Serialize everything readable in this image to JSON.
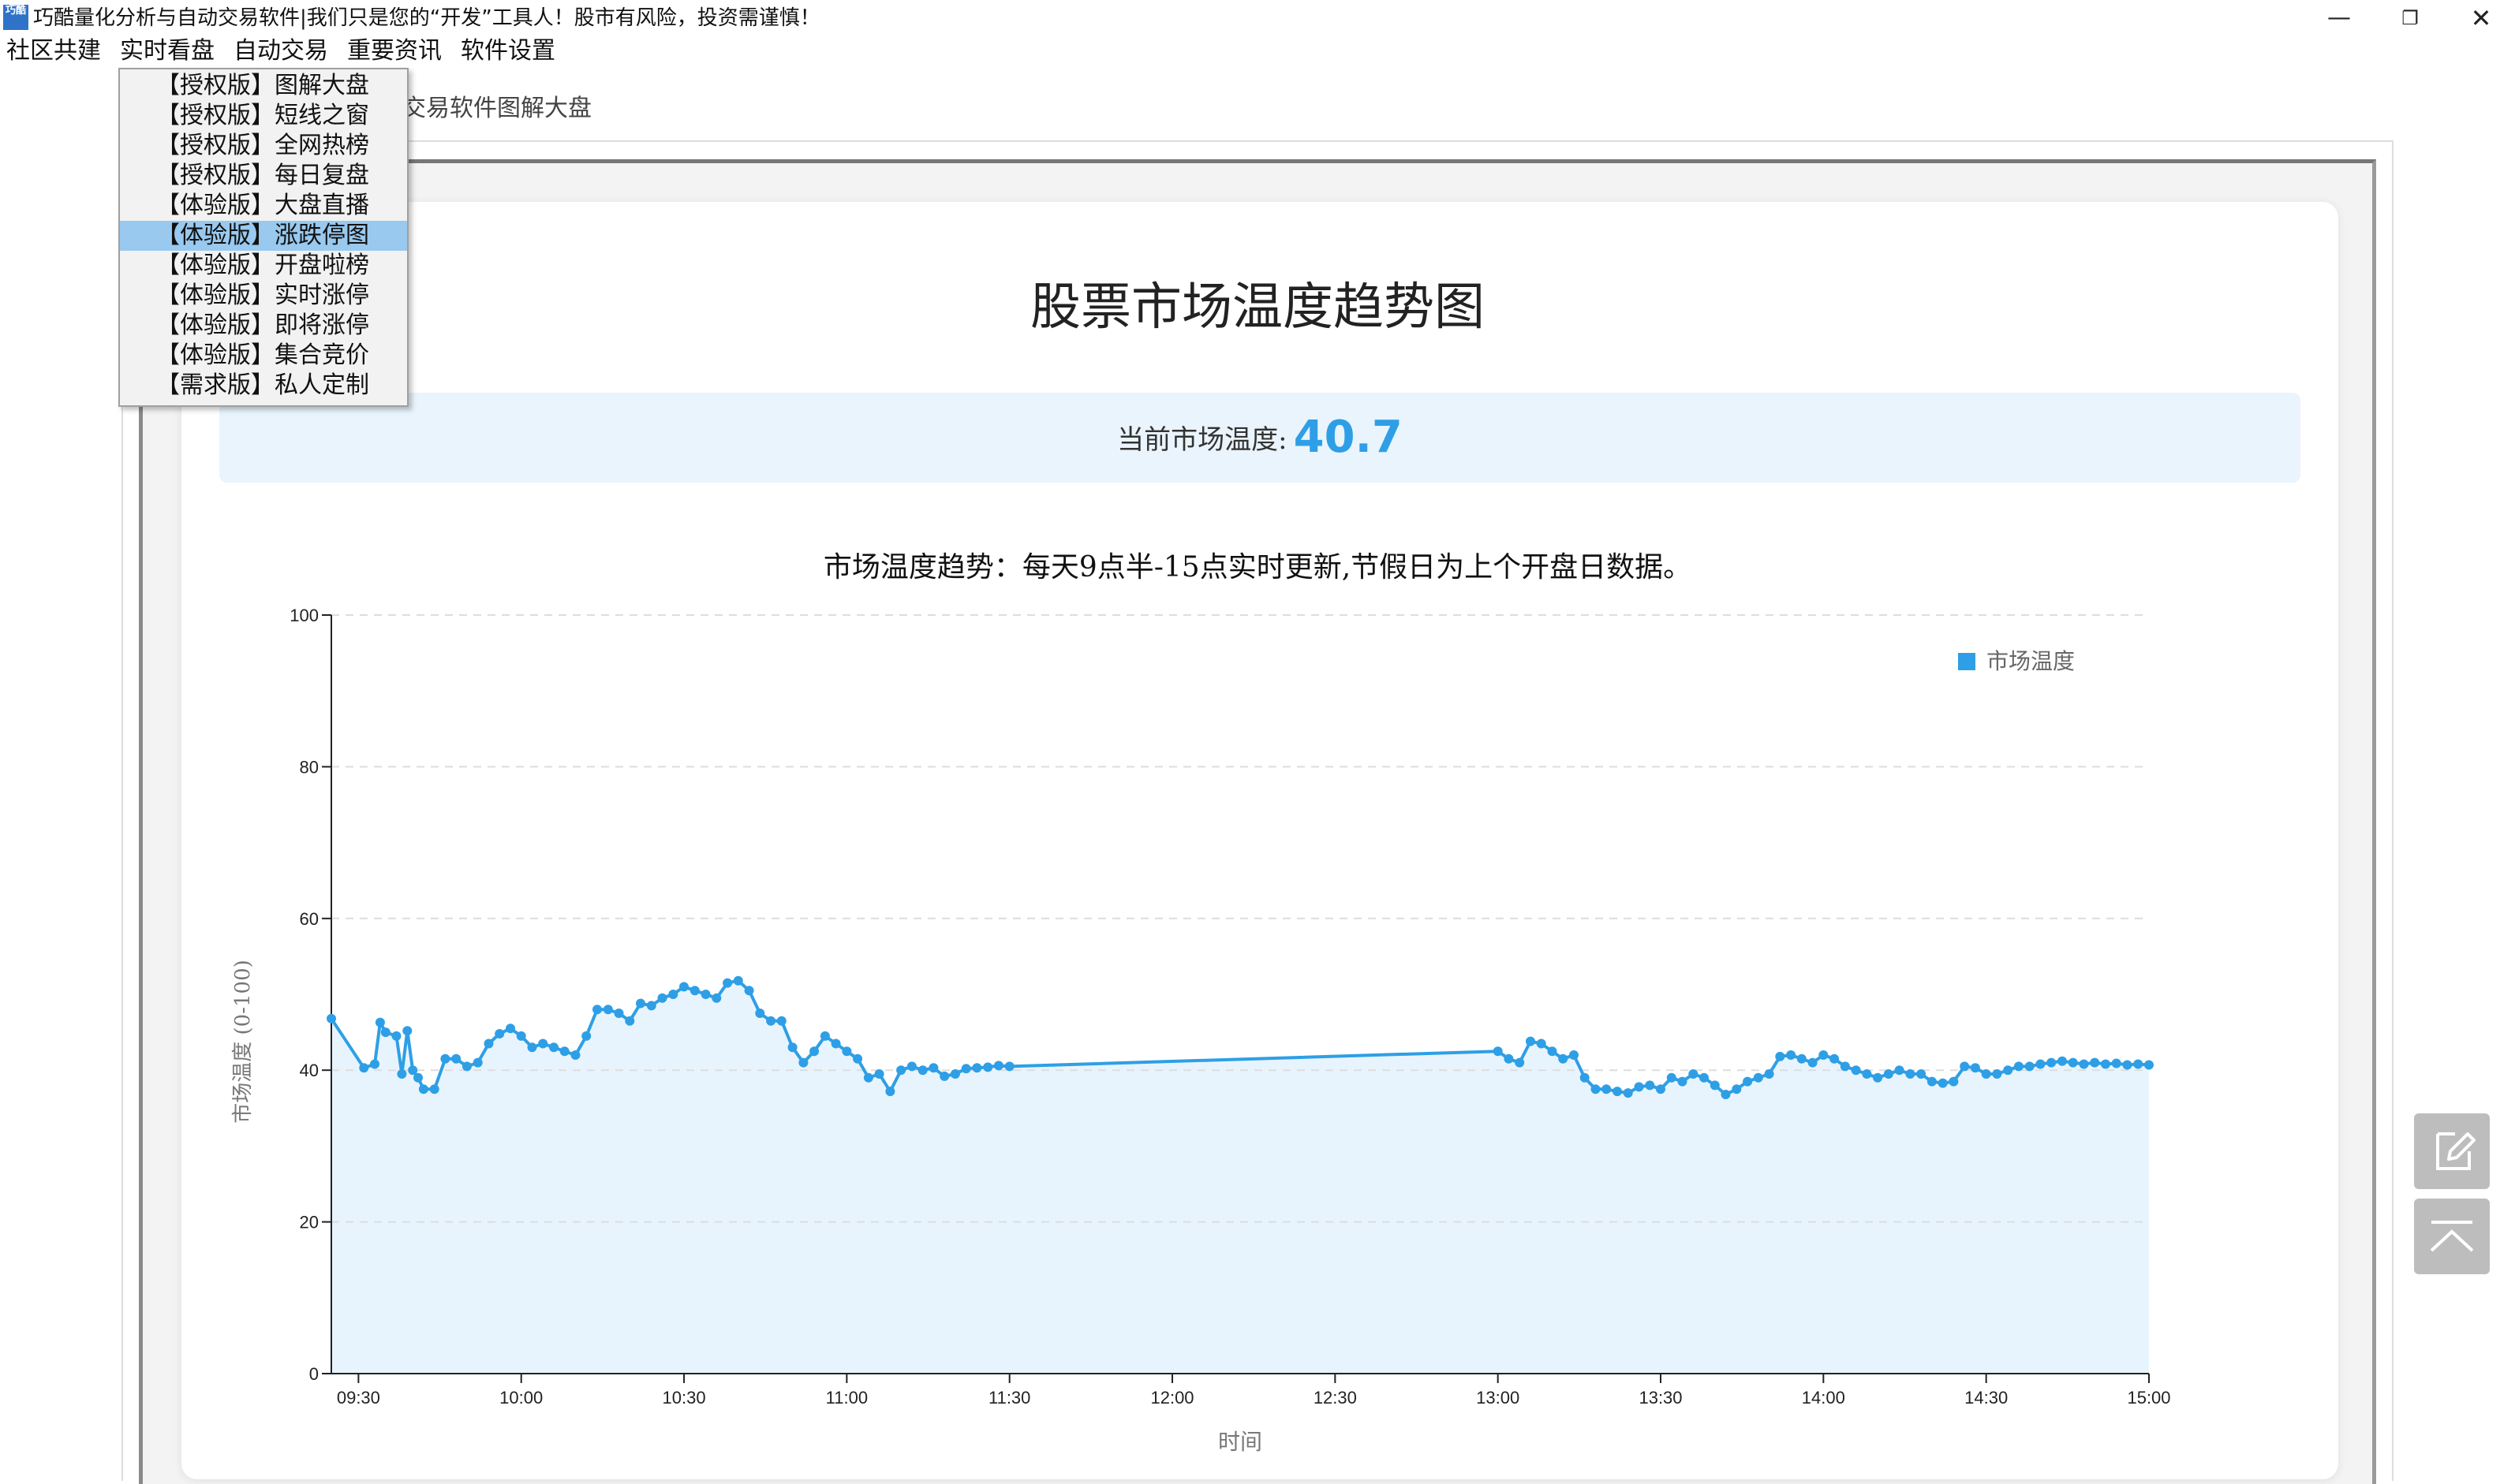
{
  "window": {
    "app_icon_text": "巧酷",
    "title": "巧酷量化分析与自动交易软件|我们只是您的“开发”工具人！股市有风险，投资需谨慎！",
    "minimize_symbol": "—",
    "maximize_symbol": "❐",
    "close_symbol": "✕"
  },
  "menubar": {
    "items": [
      "社区共建",
      "实时看盘",
      "自动交易",
      "重要资讯",
      "软件设置"
    ]
  },
  "dropdown": {
    "items": [
      "【授权版】图解大盘",
      "【授权版】短线之窗",
      "【授权版】全网热榜",
      "【授权版】每日复盘",
      "【体验版】大盘直播",
      "【体验版】涨跌停图",
      "【体验版】开盘啦榜",
      "【体验版】实时涨停",
      "【体验版】即将涨停",
      "【体验版】集合竞价",
      "【需求版】私人定制"
    ],
    "selected_index": 5
  },
  "breadcrumb": "交易软件图解大盘",
  "page": {
    "title": "股票市场温度趋势图",
    "current_label": "当前市场温度:",
    "current_value": "40.7"
  },
  "colors": {
    "accent": "#2e9fe6",
    "area_fill": "#e8f4fd",
    "selection": "#99c9ef"
  },
  "chart_data": {
    "type": "area",
    "title": "市场温度趋势：每天9点半-15点实时更新,节假日为上个开盘日数据。",
    "xlabel": "时间",
    "ylabel": "市场温度 (0-100)",
    "ylim": [
      0,
      100
    ],
    "yticks": [
      0,
      20,
      40,
      60,
      80,
      100
    ],
    "xlim": [
      "09:25",
      "15:00"
    ],
    "xticks": [
      "09:30",
      "10:00",
      "10:30",
      "11:00",
      "11:30",
      "12:00",
      "12:30",
      "13:00",
      "13:30",
      "14:00",
      "14:30",
      "15:00"
    ],
    "grid": "horizontal dashed",
    "legend_position": "top-right",
    "series": [
      {
        "name": "市场温度",
        "x": [
          "09:25",
          "09:31",
          "09:33",
          "09:34",
          "09:35",
          "09:37",
          "09:38",
          "09:39",
          "09:40",
          "09:41",
          "09:42",
          "09:44",
          "09:46",
          "09:48",
          "09:50",
          "09:52",
          "09:54",
          "09:56",
          "09:58",
          "10:00",
          "10:02",
          "10:04",
          "10:06",
          "10:08",
          "10:10",
          "10:12",
          "10:14",
          "10:16",
          "10:18",
          "10:20",
          "10:22",
          "10:24",
          "10:26",
          "10:28",
          "10:30",
          "10:32",
          "10:34",
          "10:36",
          "10:38",
          "10:40",
          "10:42",
          "10:44",
          "10:46",
          "10:48",
          "10:50",
          "10:52",
          "10:54",
          "10:56",
          "10:58",
          "11:00",
          "11:02",
          "11:04",
          "11:06",
          "11:08",
          "11:10",
          "11:12",
          "11:14",
          "11:16",
          "11:18",
          "11:20",
          "11:22",
          "11:24",
          "11:26",
          "11:28",
          "11:30",
          "13:00",
          "13:02",
          "13:04",
          "13:06",
          "13:08",
          "13:10",
          "13:12",
          "13:14",
          "13:16",
          "13:18",
          "13:20",
          "13:22",
          "13:24",
          "13:26",
          "13:28",
          "13:30",
          "13:32",
          "13:34",
          "13:36",
          "13:38",
          "13:40",
          "13:42",
          "13:44",
          "13:46",
          "13:48",
          "13:50",
          "13:52",
          "13:54",
          "13:56",
          "13:58",
          "14:00",
          "14:02",
          "14:04",
          "14:06",
          "14:08",
          "14:10",
          "14:12",
          "14:14",
          "14:16",
          "14:18",
          "14:20",
          "14:22",
          "14:24",
          "14:26",
          "14:28",
          "14:30",
          "14:32",
          "14:34",
          "14:36",
          "14:38",
          "14:40",
          "14:42",
          "14:44",
          "14:46",
          "14:48",
          "14:50",
          "14:52",
          "14:54",
          "14:56",
          "14:58",
          "15:00"
        ],
        "values": [
          46.8,
          40.3,
          40.8,
          46.3,
          45.0,
          44.5,
          39.5,
          45.2,
          40.0,
          39.0,
          37.5,
          37.5,
          41.5,
          41.5,
          40.5,
          41.0,
          43.5,
          44.8,
          45.5,
          44.5,
          43.0,
          43.5,
          43.0,
          42.5,
          42.0,
          44.5,
          48.0,
          48.0,
          47.5,
          46.5,
          48.8,
          48.5,
          49.5,
          50.0,
          51.0,
          50.5,
          50.0,
          49.5,
          51.5,
          51.8,
          50.5,
          47.5,
          46.5,
          46.5,
          43.0,
          41.0,
          42.5,
          44.5,
          43.5,
          42.5,
          41.5,
          39.0,
          39.5,
          37.2,
          40.0,
          40.5,
          40.0,
          40.3,
          39.2,
          39.5,
          40.2,
          40.3,
          40.4,
          40.6,
          40.5,
          42.5,
          41.5,
          41.0,
          43.8,
          43.5,
          42.5,
          41.5,
          42.0,
          39.0,
          37.5,
          37.5,
          37.2,
          37.0,
          37.8,
          38.0,
          37.5,
          39.0,
          38.5,
          39.5,
          39.0,
          38.0,
          36.8,
          37.5,
          38.5,
          39.0,
          39.5,
          41.8,
          42.0,
          41.5,
          41.0,
          42.0,
          41.5,
          40.5,
          40.0,
          39.5,
          39.0,
          39.5,
          40.0,
          39.5,
          39.5,
          38.5,
          38.3,
          38.5,
          40.5,
          40.3,
          39.5,
          39.5,
          40.0,
          40.5,
          40.5,
          40.8,
          41.0,
          41.2,
          41.0,
          40.8,
          41.0,
          40.8,
          40.9,
          40.7,
          40.8,
          40.7
        ]
      }
    ]
  }
}
